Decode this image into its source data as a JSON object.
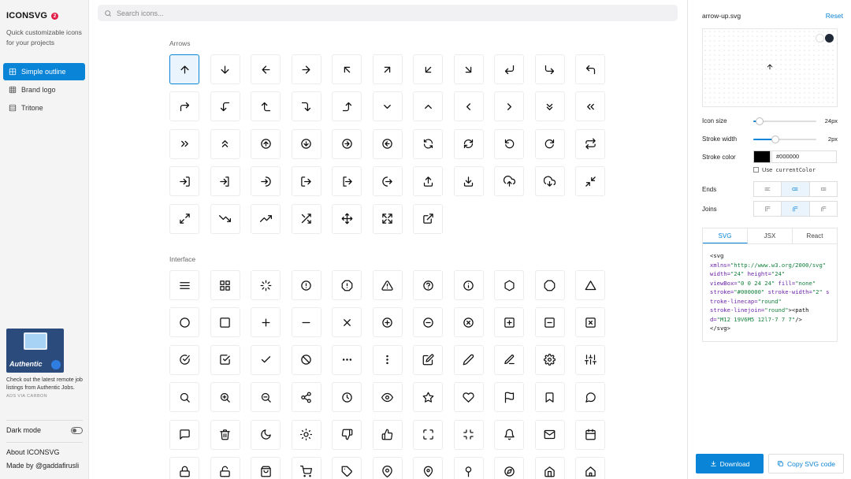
{
  "sidebar": {
    "brand": "ICONSVG",
    "badge": "2",
    "tagline": "Quick customizable icons for your projects",
    "nav": [
      {
        "label": "Simple outline",
        "active": true
      },
      {
        "label": "Brand logo",
        "active": false
      },
      {
        "label": "Tritone",
        "active": false
      }
    ],
    "ad": {
      "image_text": "Authentic",
      "copy": "Check out the latest remote job listings from Authentic Jobs.",
      "via": "ADS VIA CARBON"
    },
    "dark_mode_label": "Dark mode",
    "dark_mode_on": false,
    "about": "About ICONSVG",
    "made_by": "Made by @gaddafirusli"
  },
  "search": {
    "placeholder": "Search icons..."
  },
  "sections": [
    {
      "title": "Arrows",
      "icons": [
        "arrow-up",
        "arrow-down",
        "arrow-left",
        "arrow-right",
        "arrow-up-left",
        "arrow-up-right",
        "arrow-down-left",
        "arrow-down-right",
        "return-down-left",
        "return-down-right",
        "return-up-left",
        "turn-up-right",
        "corner-left-down",
        "corner-up-left",
        "corner-right-down",
        "corner-up-right",
        "chevron-down",
        "chevron-up",
        "chevron-left",
        "chevron-right",
        "chevrons-down",
        "chevrons-left",
        "chevrons-right",
        "chevrons-up",
        "circle-arrow-up",
        "circle-arrow-down",
        "circle-arrow-right",
        "circle-arrow-left",
        "refresh",
        "refresh-alt",
        "rotate-ccw",
        "rotate-cw",
        "repeat",
        "log-in",
        "sign-in",
        "enter",
        "log-out",
        "sign-out",
        "exit",
        "upload",
        "download",
        "cloud-upload",
        "cloud-download",
        "minimize",
        "maximize",
        "trending-down",
        "trending-up",
        "shuffle",
        "move",
        "expand",
        "external-link"
      ],
      "selected": "arrow-up"
    },
    {
      "title": "Interface",
      "icons": [
        "menu",
        "grid",
        "loader",
        "alert-circle",
        "alert-octagon",
        "alert-triangle",
        "help-circle",
        "info",
        "hexagon",
        "octagon",
        "triangle",
        "circle",
        "square",
        "plus",
        "minus",
        "x",
        "plus-circle",
        "minus-circle",
        "x-circle",
        "plus-square",
        "minus-square",
        "x-square",
        "check-circle",
        "check-square",
        "check",
        "slash",
        "more-horizontal",
        "more-vertical",
        "edit",
        "pencil",
        "edit-underline",
        "settings",
        "sliders",
        "search",
        "zoom-in",
        "zoom-out",
        "share",
        "clock",
        "eye",
        "star",
        "heart",
        "flag",
        "bookmark",
        "message-circle",
        "message-square",
        "trash",
        "moon",
        "sun",
        "thumbs-down",
        "thumbs-up",
        "fullscreen",
        "exit-fullscreen",
        "bell",
        "mail",
        "calendar",
        "lock",
        "unlock",
        "shopping-bag",
        "shopping-cart",
        "tag",
        "map-pin",
        "pin",
        "pin-alt",
        "compass",
        "home",
        "home-alt"
      ]
    }
  ],
  "panel": {
    "filename": "arrow-up.svg",
    "reset_label": "Reset",
    "icon_size_label": "Icon size",
    "icon_size_value": "24px",
    "icon_size_fraction": 0.1,
    "stroke_width_label": "Stroke width",
    "stroke_width_value": "2px",
    "stroke_width_fraction": 0.35,
    "stroke_color_label": "Stroke color",
    "stroke_color_value": "#000000",
    "use_current_color_prefix": "Use",
    "use_current_color_code": "currentColor",
    "ends_label": "Ends",
    "joins_label": "Joins",
    "tabs": [
      {
        "label": "SVG",
        "active": true
      },
      {
        "label": "JSX",
        "active": false
      },
      {
        "label": "React",
        "active": false
      }
    ],
    "download_label": "Download",
    "copy_label": "Copy SVG code"
  },
  "code": {
    "tag_open": "<svg",
    "xmlns_attr": "xmlns=",
    "xmlns_val": "\"http://www.w3.org/2000/svg\"",
    "width_attr": " width=",
    "width_val": "\"24\"",
    "height_attr": " height=",
    "height_val": "\"24\"",
    "viewbox_attr": "viewBox=",
    "viewbox_val": "\"0 0 24 24\"",
    "fill_attr": " fill=",
    "fill_val": "\"none\"",
    "stroke_attr": "stroke=",
    "stroke_val": "\"#000000\"",
    "sw_attr": " stroke-width=",
    "sw_val": "\"2\"",
    "lc_attr": " stroke-linecap=",
    "lc_val": "\"round\"",
    "lj_attr": "stroke-linejoin=",
    "lj_val": "\"round\"",
    "path_open": "><path",
    "d_attr": "d=",
    "d_val": "\"M12 19V6M5 12l7-7 7 7\"",
    "close": "/>",
    "tag_close": "</svg>"
  }
}
